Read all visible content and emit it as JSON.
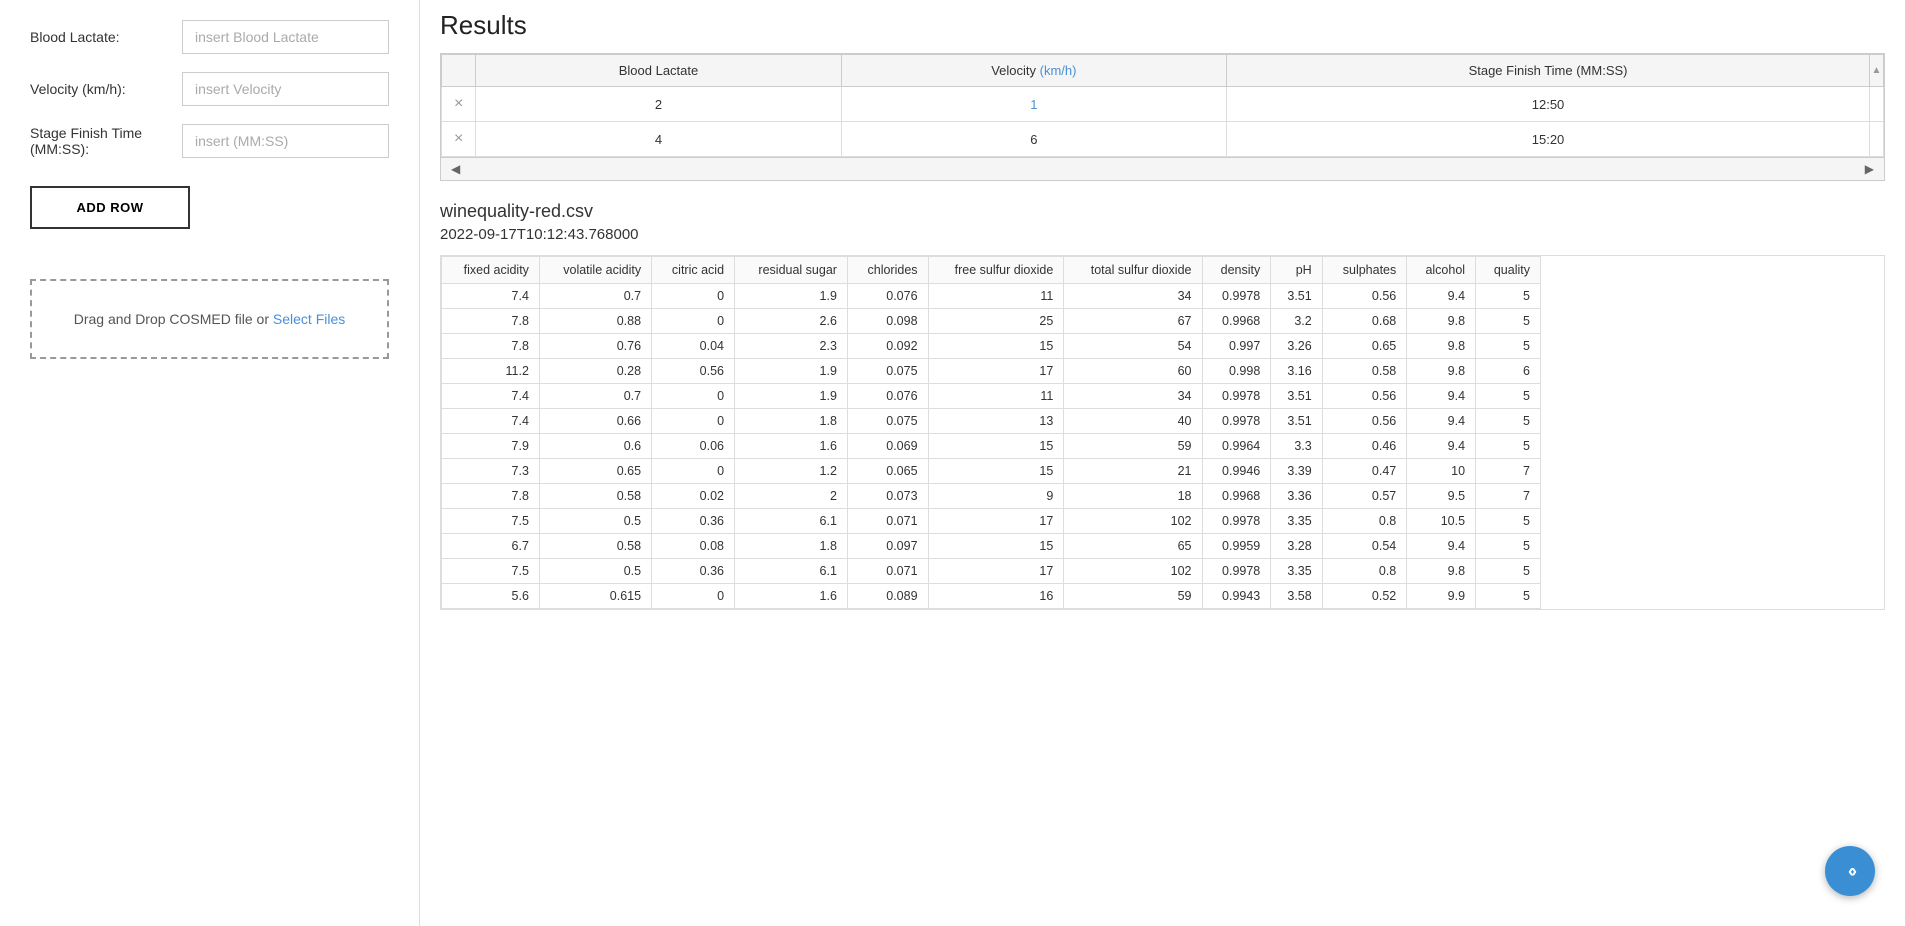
{
  "left_panel": {
    "blood_lactate_label": "Blood Lactate:",
    "blood_lactate_placeholder": "insert Blood Lactate",
    "velocity_label": "Velocity (km/h):",
    "velocity_placeholder": "insert Velocity",
    "stage_finish_time_label": "Stage Finish Time (MM:SS):",
    "stage_finish_time_placeholder": "insert (MM:SS)",
    "add_row_button": "ADD ROW",
    "drop_zone_text": "Drag and Drop COSMED file or ",
    "select_files_link": "Select Files"
  },
  "results": {
    "title": "Results",
    "table_headers": [
      "",
      "Blood Lactate",
      "Velocity (km/h)",
      "Stage Finish Time (MM:SS)"
    ],
    "rows": [
      {
        "delete": "×",
        "blood_lactate": "2",
        "velocity": "1",
        "velocity_is_link": true,
        "stage_finish_time": "12:50"
      },
      {
        "delete": "×",
        "blood_lactate": "4",
        "velocity": "6",
        "velocity_is_link": false,
        "stage_finish_time": "15:20"
      }
    ]
  },
  "csv": {
    "filename": "winequality-red.csv",
    "timestamp": "2022-09-17T10:12:43.768000",
    "table_headers": [
      "fixed acidity",
      "volatile acidity",
      "citric acid",
      "residual sugar",
      "chlorides",
      "free sulfur dioxide",
      "total sulfur dioxide",
      "density",
      "pH",
      "sulphates",
      "alcohol",
      "quality"
    ],
    "rows": [
      [
        7.4,
        0.7,
        0,
        1.9,
        0.076,
        11,
        34,
        0.9978,
        3.51,
        0.56,
        9.4,
        5
      ],
      [
        7.8,
        0.88,
        0,
        2.6,
        0.098,
        25,
        67,
        0.9968,
        3.2,
        0.68,
        9.8,
        5
      ],
      [
        7.8,
        0.76,
        0.04,
        2.3,
        0.092,
        15,
        54,
        0.997,
        3.26,
        0.65,
        9.8,
        5
      ],
      [
        11.2,
        0.28,
        0.56,
        1.9,
        0.075,
        17,
        60,
        0.998,
        3.16,
        0.58,
        9.8,
        6
      ],
      [
        7.4,
        0.7,
        0,
        1.9,
        0.076,
        11,
        34,
        0.9978,
        3.51,
        0.56,
        9.4,
        5
      ],
      [
        7.4,
        0.66,
        0,
        1.8,
        0.075,
        13,
        40,
        0.9978,
        3.51,
        0.56,
        9.4,
        5
      ],
      [
        7.9,
        0.6,
        0.06,
        1.6,
        0.069,
        15,
        59,
        0.9964,
        3.3,
        0.46,
        9.4,
        5
      ],
      [
        7.3,
        0.65,
        0,
        1.2,
        0.065,
        15,
        21,
        0.9946,
        3.39,
        0.47,
        10,
        7
      ],
      [
        7.8,
        0.58,
        0.02,
        2,
        0.073,
        9,
        18,
        0.9968,
        3.36,
        0.57,
        9.5,
        7
      ],
      [
        7.5,
        0.5,
        0.36,
        6.1,
        0.071,
        17,
        102,
        0.9978,
        3.35,
        0.8,
        10.5,
        5
      ],
      [
        6.7,
        0.58,
        0.08,
        1.8,
        0.097,
        15,
        65,
        0.9959,
        3.28,
        0.54,
        9.4,
        5
      ],
      [
        7.5,
        0.5,
        0.36,
        6.1,
        0.071,
        17,
        102,
        0.9978,
        3.35,
        0.8,
        9.8,
        5
      ],
      [
        5.6,
        0.615,
        0,
        1.6,
        0.089,
        16,
        59,
        0.9943,
        3.58,
        0.52,
        9.9,
        5
      ]
    ]
  },
  "nav_button": {
    "label": "‹›"
  }
}
